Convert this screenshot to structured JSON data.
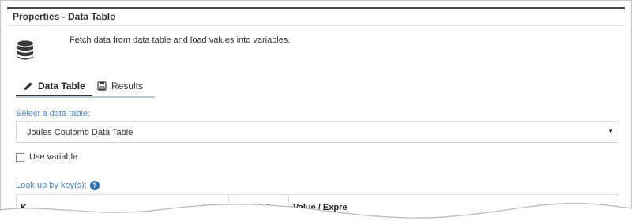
{
  "panel": {
    "title": "Properties - Data Table"
  },
  "intro": {
    "icon": "database-icon",
    "description": "Fetch data from data table and load values into variables."
  },
  "tabs": [
    {
      "label": "Data Table",
      "icon": "pencil-icon",
      "active": true
    },
    {
      "label": "Results",
      "icon": "save-icon",
      "active": false
    }
  ],
  "data_table_select": {
    "label": "Select a data table:",
    "value": "Joules Coulomb Data Table"
  },
  "use_variable": {
    "label": "Use variable",
    "checked": false
  },
  "lookup": {
    "label": "Look up by key(s):",
    "columns": [
      "K",
      "Variable?",
      "Value / Expre"
    ]
  },
  "colors": {
    "accent": "#4a86c8",
    "help": "#2f6db3",
    "active_tab": "#333333"
  }
}
